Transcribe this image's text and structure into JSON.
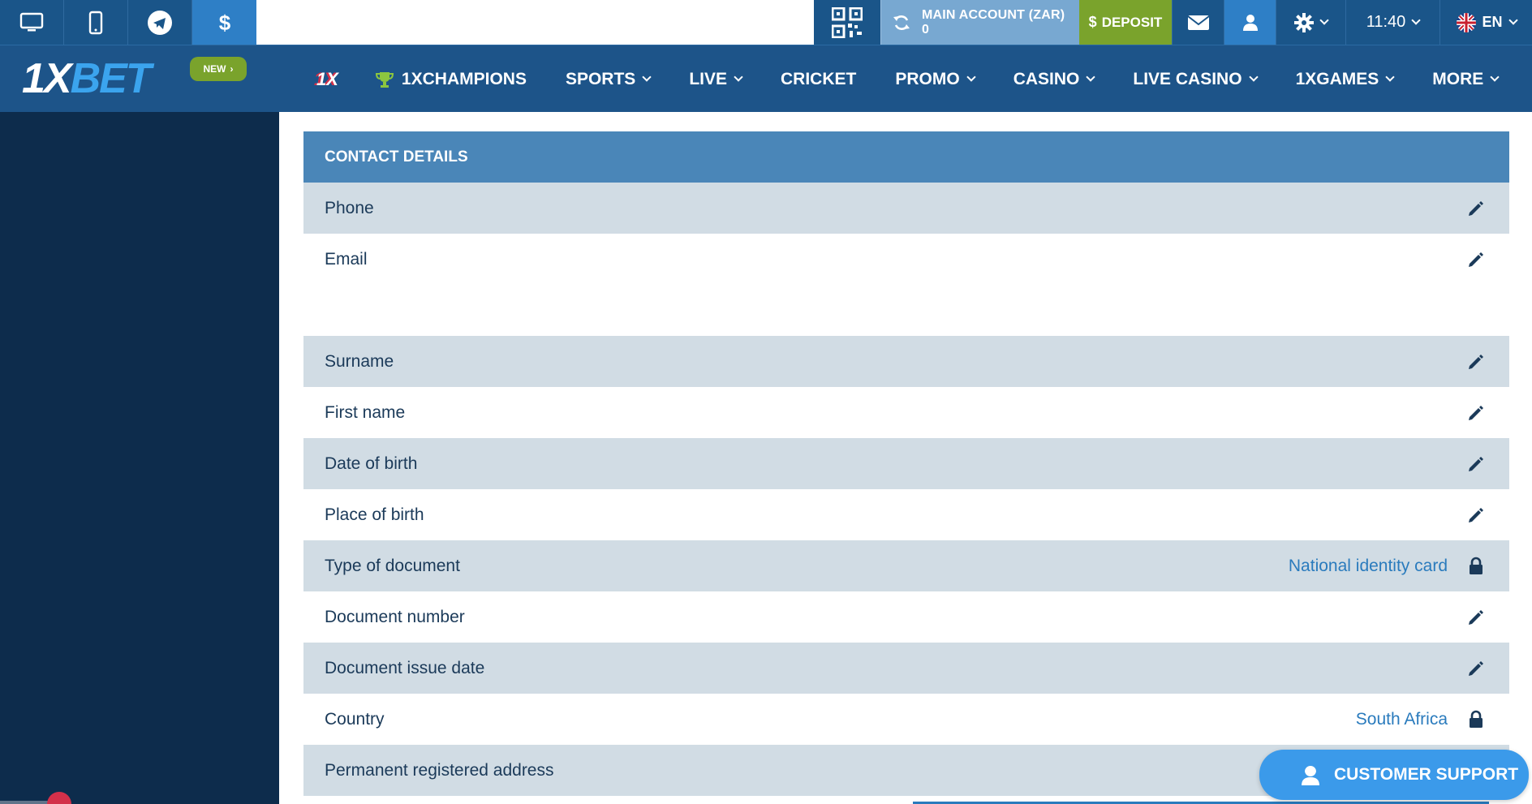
{
  "topbar": {
    "left_icons": [
      "desktop-icon",
      "mobile-icon",
      "telegram-icon",
      "dollar-icon"
    ],
    "account_label": "MAIN ACCOUNT (ZAR)",
    "account_balance": "0",
    "deposit_label": "DEPOSIT",
    "deposit_symbol": "$",
    "time": "11:40",
    "language": "EN"
  },
  "nav": {
    "logo_part1": "1X",
    "logo_part2": "BET",
    "new_badge": "NEW",
    "items": [
      {
        "label": "1X",
        "dropdown": false
      },
      {
        "label": "1XCHAMPIONS",
        "dropdown": false
      },
      {
        "label": "SPORTS",
        "dropdown": true
      },
      {
        "label": "LIVE",
        "dropdown": true
      },
      {
        "label": "CRICKET",
        "dropdown": false
      },
      {
        "label": "PROMO",
        "dropdown": true
      },
      {
        "label": "CASINO",
        "dropdown": true
      },
      {
        "label": "LIVE CASINO",
        "dropdown": true
      },
      {
        "label": "1XGAMES",
        "dropdown": true
      },
      {
        "label": "MORE",
        "dropdown": true
      }
    ]
  },
  "content": {
    "section_title": "CONTACT DETAILS",
    "contact_rows": [
      {
        "label": "Phone",
        "value": "",
        "icon": "pencil-icon"
      },
      {
        "label": "Email",
        "value": "",
        "icon": "pencil-icon"
      }
    ],
    "personal_rows": [
      {
        "label": "Surname",
        "value": "",
        "icon": "pencil-icon"
      },
      {
        "label": "First name",
        "value": "",
        "icon": "pencil-icon"
      },
      {
        "label": "Date of birth",
        "value": "",
        "icon": "pencil-icon"
      },
      {
        "label": "Place of birth",
        "value": "",
        "icon": "pencil-icon"
      },
      {
        "label": "Type of document",
        "value": "National identity card",
        "icon": "lock-icon"
      },
      {
        "label": "Document number",
        "value": "",
        "icon": "pencil-icon"
      },
      {
        "label": "Document issue date",
        "value": "",
        "icon": "pencil-icon"
      },
      {
        "label": "Country",
        "value": "South Africa",
        "icon": "lock-icon"
      },
      {
        "label": "Permanent registered address",
        "value": "",
        "icon": ""
      }
    ]
  },
  "support": {
    "label": "CUSTOMER SUPPORT"
  },
  "colors": {
    "nav_bg": "#1d5489",
    "sidebar_bg": "#0d2c4c",
    "header_bg": "#4a86b8",
    "row_grey": "#d1dce4",
    "deposit": "#7aa32c",
    "accent_blue": "#2a7bbd"
  }
}
